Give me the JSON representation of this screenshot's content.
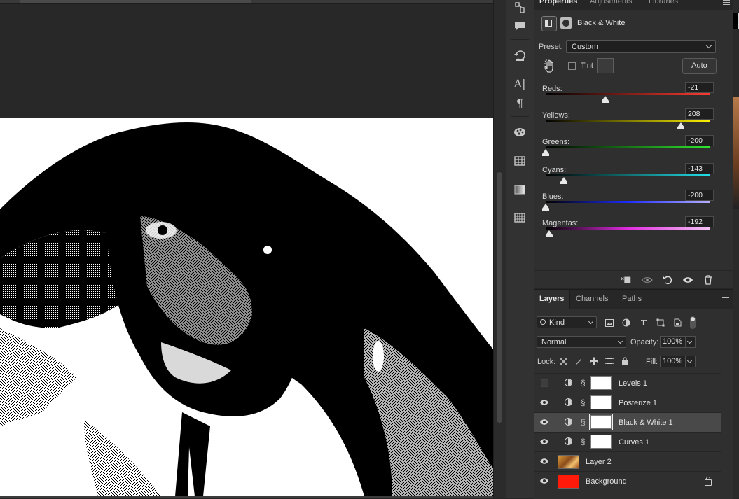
{
  "properties": {
    "tabs": [
      "Properties",
      "Adjustments",
      "Libraries"
    ],
    "adjustment_title": "Black & White",
    "preset_label": "Preset:",
    "preset_value": "Custom",
    "tint_label": "Tint",
    "auto_label": "Auto",
    "sliders": [
      {
        "label": "Reds:",
        "value": "-21",
        "fraction": 0.36,
        "gradient": "linear-gradient(to right,#000,#ff3b30)"
      },
      {
        "label": "Yellows:",
        "value": "208",
        "fraction": 0.82,
        "gradient": "linear-gradient(to right,#000,#fff200)"
      },
      {
        "label": "Greens:",
        "value": "-200",
        "fraction": 0.0,
        "gradient": "linear-gradient(to right,#000,#2ee82e)"
      },
      {
        "label": "Cyans:",
        "value": "-143",
        "fraction": 0.11,
        "gradient": "linear-gradient(to right,#000,#22e0e8)"
      },
      {
        "label": "Blues:",
        "value": "-200",
        "fraction": 0.0,
        "gradient": "linear-gradient(to right,#000,#1d2bff,#b6b0ff)"
      },
      {
        "label": "Magentas:",
        "value": "-192",
        "fraction": 0.02,
        "gradient": "linear-gradient(to right,#000,#e02ce0,#f4c4f4)"
      }
    ]
  },
  "layers": {
    "tabs": [
      "Layers",
      "Channels",
      "Paths"
    ],
    "filter_kind": "Kind",
    "blend_mode": "Normal",
    "opacity_label": "Opacity:",
    "opacity_value": "100%",
    "lock_label": "Lock:",
    "fill_label": "Fill:",
    "fill_value": "100%",
    "items": [
      {
        "name": "Levels 1",
        "type": "adjustment",
        "visible": false,
        "selected": false
      },
      {
        "name": "Posterize 1",
        "type": "adjustment",
        "visible": true,
        "selected": false
      },
      {
        "name": "Black & White 1",
        "type": "adjustment",
        "visible": true,
        "selected": true
      },
      {
        "name": "Curves 1",
        "type": "adjustment",
        "visible": true,
        "selected": false
      },
      {
        "name": "Layer 2",
        "type": "image",
        "visible": true,
        "selected": false
      },
      {
        "name": "Background",
        "type": "fill",
        "visible": true,
        "selected": false,
        "locked": true,
        "color": "#ff1a0a"
      }
    ]
  },
  "colors": {
    "accent_background_layer": "#ff1a0a",
    "panel_bg": "#2f2f2f"
  },
  "icons": {
    "tool_strip": [
      "history-brush-icon",
      "comment-icon",
      "history-icon",
      "character-icon",
      "paragraph-icon",
      "swatches-icon",
      "table-icon",
      "gradient-icon",
      "grid-icon"
    ],
    "props_footer": [
      "clip-to-layer-icon",
      "view-previous-icon",
      "reset-icon",
      "visibility-icon",
      "delete-icon"
    ]
  }
}
